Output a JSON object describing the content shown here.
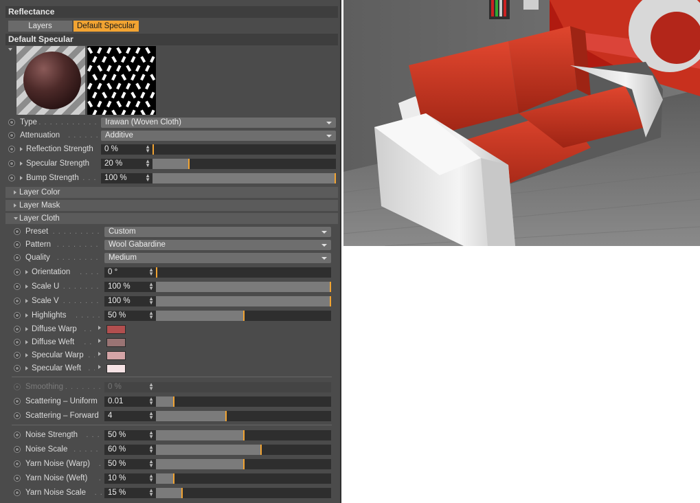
{
  "panel": {
    "header": "Reflectance",
    "tabs": [
      "Layers",
      "Default Specular"
    ],
    "layer_title": "Default Specular",
    "properties": [
      {
        "label": "Type",
        "kind": "dropdown",
        "value": "Irawan (Woven Cloth)"
      },
      {
        "label": "Attenuation",
        "kind": "dropdown",
        "value": "Additive"
      },
      {
        "label": "Reflection Strength",
        "kind": "slider",
        "value": "0 %",
        "fraction": 0.0
      },
      {
        "label": "Specular Strength",
        "kind": "slider",
        "value": "20 %",
        "fraction": 0.2
      },
      {
        "label": "Bump Strength",
        "kind": "slider",
        "value": "100 %",
        "fraction": 1.0
      }
    ],
    "sections": [
      "Layer Color",
      "Layer Mask",
      "Layer Cloth"
    ],
    "cloth": {
      "dropdowns": [
        {
          "label": "Preset",
          "value": "Custom"
        },
        {
          "label": "Pattern",
          "value": "Wool Gabardine"
        },
        {
          "label": "Quality",
          "value": "Medium"
        }
      ],
      "sliders": [
        {
          "label": "Orientation",
          "value": "0 °",
          "fraction": 0.0
        },
        {
          "label": "Scale U",
          "value": "100 %",
          "fraction": 1.0
        },
        {
          "label": "Scale V",
          "value": "100 %",
          "fraction": 1.0
        },
        {
          "label": "Highlights",
          "value": "50 %",
          "fraction": 0.5
        }
      ],
      "colors": [
        {
          "label": "Diffuse Warp",
          "color": "#b24f4f"
        },
        {
          "label": "Diffuse Weft",
          "color": "#9a7474"
        },
        {
          "label": "Specular Warp",
          "color": "#d4a4a6"
        },
        {
          "label": "Specular Weft",
          "color": "#f6e3e5"
        }
      ],
      "scatter": [
        {
          "label": "Smoothing",
          "value": "0 %",
          "fraction": 0.0,
          "disabled": true
        },
        {
          "label": "Scattering – Uniform",
          "value": "0.01",
          "fraction": 0.1
        },
        {
          "label": "Scattering – Forward",
          "value": "4",
          "fraction": 0.4
        }
      ],
      "noise": [
        {
          "label": "Noise Strength",
          "value": "50 %",
          "fraction": 0.5
        },
        {
          "label": "Noise Scale",
          "value": "60 %",
          "fraction": 0.6
        },
        {
          "label": "Yarn Noise (Warp)",
          "value": "50 %",
          "fraction": 0.5
        },
        {
          "label": "Yarn Noise (Weft)",
          "value": "10 %",
          "fraction": 0.1
        },
        {
          "label": "Yarn Noise Scale",
          "value": "15 %",
          "fraction": 0.15
        }
      ]
    }
  },
  "colors": {
    "accent": "#f2a432",
    "panel_bg": "#4b4b4b",
    "sofa_red": "#c8301e"
  }
}
